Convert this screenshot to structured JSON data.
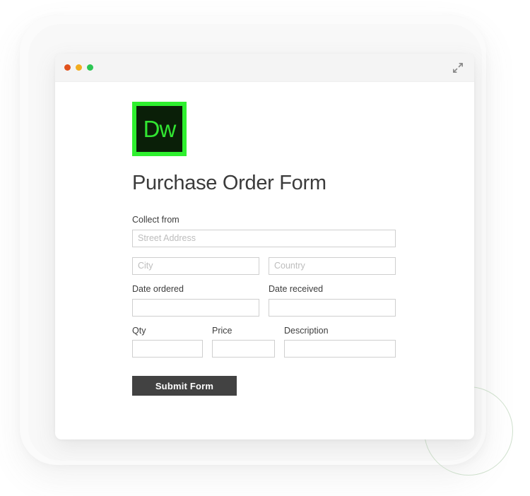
{
  "window": {
    "controls": {
      "close_label": "close",
      "minimize_label": "minimize",
      "maximize_label": "maximize",
      "expand_label": "expand"
    }
  },
  "brand": {
    "logo_text": "Dw",
    "logo_border_color": "#2ef02e",
    "logo_bg_color": "#0a1f08",
    "logo_text_color": "#31e531"
  },
  "form": {
    "title": "Purchase Order Form",
    "collect_from_label": "Collect from",
    "street_placeholder": "Street Address",
    "street_value": "",
    "city_placeholder": "City",
    "city_value": "",
    "country_placeholder": "Country",
    "country_value": "",
    "date_ordered_label": "Date ordered",
    "date_ordered_placeholder": "",
    "date_ordered_value": "",
    "date_received_label": "Date received",
    "date_received_placeholder": "",
    "date_received_value": "",
    "qty_label": "Qty",
    "qty_placeholder": "",
    "qty_value": "",
    "price_label": "Price",
    "price_placeholder": "",
    "price_value": "",
    "description_label": "Description",
    "description_placeholder": "",
    "description_value": "",
    "submit_label": "Submit Form",
    "submit_bg_color": "#424242"
  },
  "decor": {
    "circle_color": "#cfe0cd"
  }
}
